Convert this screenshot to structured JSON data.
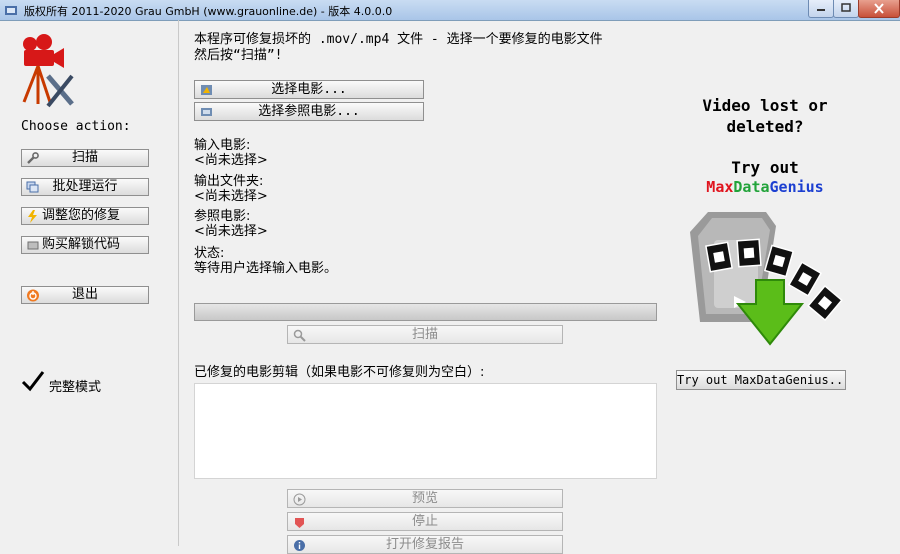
{
  "window": {
    "title": "版权所有 2011-2020 Grau GmbH (www.grauonline.de) - 版本 4.0.0.0"
  },
  "sidebar": {
    "choose_action": "Choose action:",
    "buttons": [
      {
        "label": "扫描",
        "icon": "wrench-icon"
      },
      {
        "label": "批处理运行",
        "icon": "batch-icon"
      },
      {
        "label": "调整您的修复",
        "icon": "lightning-icon"
      },
      {
        "label": "购买解锁代码",
        "icon": "cart-icon"
      },
      {
        "label": "退出",
        "icon": "power-icon"
      }
    ],
    "full_mode": "完整模式"
  },
  "main": {
    "instructions": "本程序可修复损坏的 .mov/.mp4 文件 - 选择一个要修复的电影文件\n然后按“扫描”!",
    "select_movie": "选择电影...",
    "select_reference": "选择参照电影...",
    "input_movie_label": "输入电影:",
    "input_movie_value": "<尚未选择>",
    "output_folder_label": "输出文件夹:",
    "output_folder_value": "<尚未选择>",
    "reference_movie_label": "参照电影:",
    "reference_movie_value": "<尚未选择>",
    "status_label": "状态:",
    "status_value": "等待用户选择输入电影。",
    "progress": 0,
    "scan_button": "扫描",
    "repaired_label": "已修复的电影剪辑（如果电影不可修复则为空白）:",
    "preview_button": "预览",
    "stop_button": "停止",
    "report_button": "打开修复报告"
  },
  "ad": {
    "headline_line1": "Video lost or",
    "headline_line2": "deleted?",
    "try_out": "Try out",
    "brand_max": "Max",
    "brand_data": "Data",
    "brand_genius": "Genius",
    "button": "Try out MaxDataGenius...",
    "colors": {
      "max": "#e0141e",
      "data": "#22a33a",
      "genius": "#1c3fd1"
    }
  }
}
